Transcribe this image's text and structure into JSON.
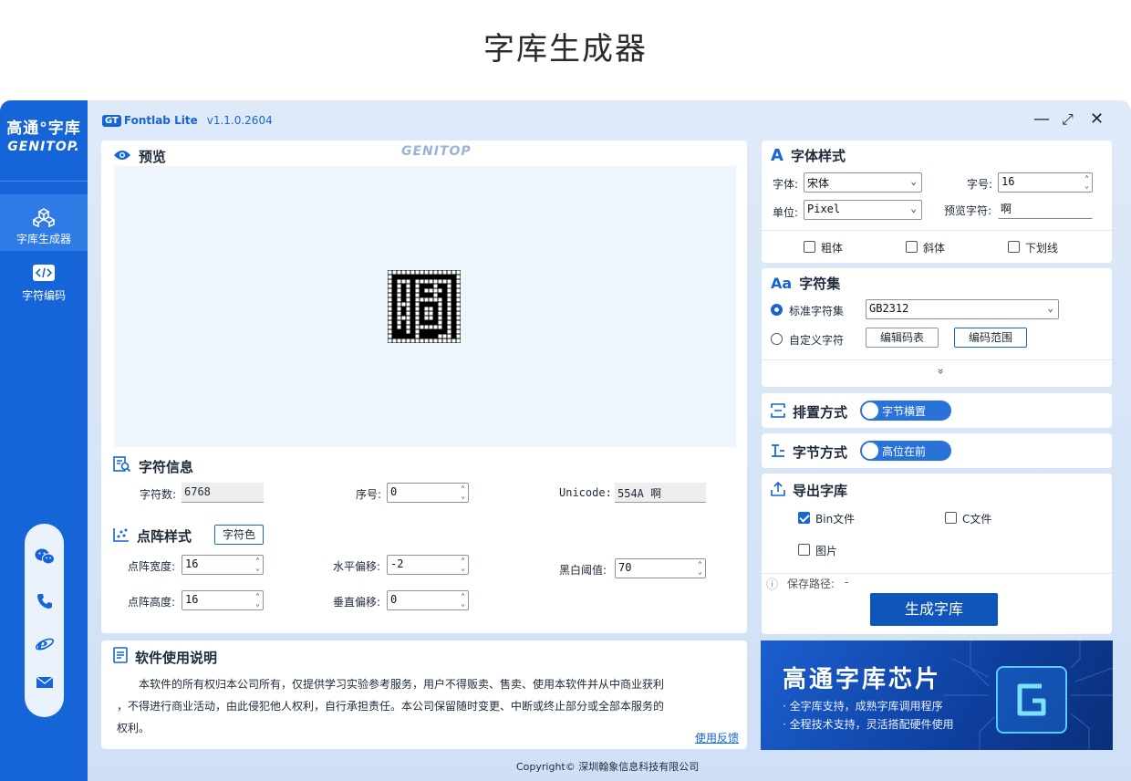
{
  "page_title": "字库生成器",
  "sidebar": {
    "brand_cn": "高通°字库",
    "brand_en": "GENITOP.",
    "nav": [
      {
        "label": "字库生成器",
        "icon": "cubes-icon",
        "active": true
      },
      {
        "label": "字符编码",
        "icon": "code-icon",
        "active": false
      }
    ],
    "contacts": [
      "wechat-icon",
      "phone-icon",
      "browser-icon",
      "mail-icon"
    ]
  },
  "titlebar": {
    "badge": "GT",
    "app_name": "Fontlab Lite",
    "version": "v1.1.0.2604",
    "minimize": "—",
    "maximize": "⤢",
    "close": "✕"
  },
  "preview": {
    "title": "预览",
    "watermark": "GENITOP"
  },
  "char_info": {
    "title": "字符信息",
    "count_label": "字符数:",
    "count_value": "6768",
    "index_label": "序号:",
    "index_value": "0",
    "unicode_label": "Unicode:",
    "unicode_value": "554A 啊"
  },
  "matrix_style": {
    "title": "点阵样式",
    "char_color_btn": "字符色",
    "width_label": "点阵宽度:",
    "width_value": "16",
    "height_label": "点阵高度:",
    "height_value": "16",
    "hoffset_label": "水平偏移:",
    "hoffset_value": "-2",
    "voffset_label": "垂直偏移:",
    "voffset_value": "0",
    "threshold_label": "黑白阈值:",
    "threshold_value": "70"
  },
  "usage": {
    "title": "软件使用说明",
    "line1": "本软件的所有权归本公司所有，仅提供学习实验参考服务，用户不得贩卖、售卖、使用本软件并从中商业获利",
    "line2": "，不得进行商业活动，由此侵犯他人权利，自行承担责任。本公司保留随时变更、中断或终止部分或全部本服务的",
    "line3": "权利。",
    "feedback": "使用反馈"
  },
  "font_style": {
    "title": "字体样式",
    "font_label": "字体:",
    "font_value": "宋体",
    "size_label": "字号:",
    "size_value": "16",
    "unit_label": "单位:",
    "unit_value": "Pixel",
    "preview_char_label": "预览字符:",
    "preview_char_value": "啊",
    "bold": "粗体",
    "italic": "斜体",
    "underline": "下划线"
  },
  "charset": {
    "title": "字符集",
    "standard_label": "标准字符集",
    "standard_value": "GB2312",
    "custom_label": "自定义字符",
    "edit_table_btn": "编辑码表",
    "edit_range_btn": "编码范围",
    "expand": "»"
  },
  "arrangement": {
    "title": "排置方式",
    "toggle": "字节横置"
  },
  "byte_order": {
    "title": "字节方式",
    "toggle": "高位在前"
  },
  "export": {
    "title": "导出字库",
    "bin_label": "Bin文件",
    "bin_checked": true,
    "c_label": "C文件",
    "c_checked": false,
    "image_label": "图片",
    "image_checked": false,
    "save_path_label": "保存路径:",
    "save_path_value": "-",
    "generate_btn": "生成字库"
  },
  "banner": {
    "title": "高通字库芯片",
    "line1": "· 全字库支持，成熟字库调用程序",
    "line2": "· 全程技术支持，灵活搭配硬件使用"
  },
  "footer": {
    "copyright": "Copyright© 深圳翰象信息科技有限公司"
  },
  "colors": {
    "accent": "#1565d8",
    "sidebar": "#1565d8",
    "window_bg": "#dfeaf9"
  },
  "glyph_bitmap": [
    "1111111111111111",
    "1000000000000001",
    "1011101111111101",
    "1010101000100101",
    "1010101011110101",
    "1010101000100101",
    "1010101111110101",
    "1011101000010101",
    "1010101011010101",
    "1010101011010101",
    "1011101011010101",
    "1010101000010101",
    "1010101111110101",
    "1000101000000101",
    "1000001000011101",
    "1111111111111111"
  ]
}
